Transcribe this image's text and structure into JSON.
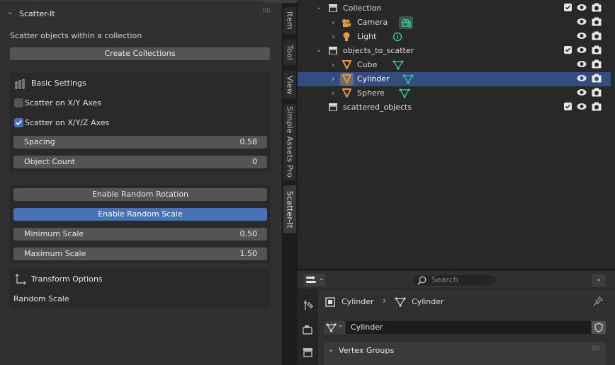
{
  "left_panel": {
    "title": "Scatter-It",
    "description": "Scatter objects within a collection",
    "create_button": "Create Collections",
    "basic_settings": {
      "title": "Basic Settings",
      "checkbox_xy": {
        "label": "Scatter on X/Y Axes",
        "checked": false
      },
      "checkbox_xyz": {
        "label": "Scatter on X/Y/Z Axes",
        "checked": true
      },
      "spacing": {
        "label": "Spacing",
        "value": "0.58"
      },
      "object_count": {
        "label": "Object Count",
        "value": "0"
      }
    },
    "random": {
      "rotation_button": "Enable Random Rotation",
      "scale_button": "Enable Random Scale",
      "min_scale": {
        "label": "Minimum Scale",
        "value": "0.50"
      },
      "max_scale": {
        "label": "Maximum Scale",
        "value": "1.50"
      }
    },
    "transform": {
      "title": "Transform Options",
      "text": "Random Scale"
    }
  },
  "side_tabs": [
    "Item",
    "Tool",
    "View",
    "Simple Assets Pro",
    "Scatter-It"
  ],
  "outliner": {
    "rows": [
      {
        "name": "Collection",
        "type": "collection-icon"
      },
      {
        "name": "Camera",
        "type": "camera-icon"
      },
      {
        "name": "Light",
        "type": "light-icon"
      },
      {
        "name": "objects_to_scatter",
        "type": "collection-icon"
      },
      {
        "name": "Cube",
        "type": "mesh-icon"
      },
      {
        "name": "Cylinder",
        "type": "mesh-icon"
      },
      {
        "name": "Sphere",
        "type": "mesh-icon"
      },
      {
        "name": "scattered_objects",
        "type": "collection-icon"
      }
    ]
  },
  "properties": {
    "search_placeholder": "Search",
    "breadcrumb_object": "Cylinder",
    "breadcrumb_mesh": "Cylinder",
    "mesh_name": "Cylinder",
    "vertex_groups": "Vertex Groups"
  },
  "colors": {
    "accent": "#4772b3",
    "selection": "#334d80",
    "mesh": "#e09a3c",
    "data": "#3fd6a0"
  }
}
